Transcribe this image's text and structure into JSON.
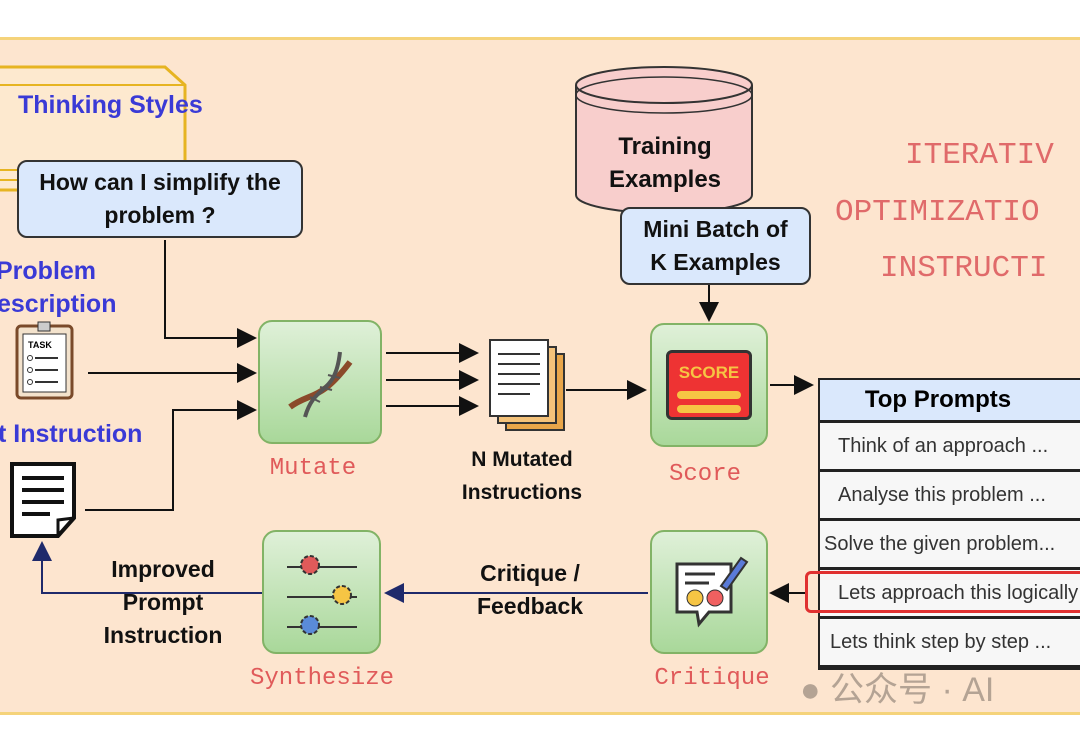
{
  "thinking_styles": {
    "title": "Thinking Styles",
    "example": "How can I simplify the problem ?"
  },
  "problem_description": {
    "line1": "Problem",
    "line2": "escription"
  },
  "instruction_label": "t Instruction",
  "mutate": {
    "label": "Mutate",
    "icon": "dna-icon"
  },
  "mutated": {
    "label_line1": "N Mutated",
    "label_line2": "Instructions"
  },
  "training": {
    "line1": "Training",
    "line2": "Examples"
  },
  "mini_batch": {
    "line1": "Mini Batch of",
    "line2": "K Examples"
  },
  "score": {
    "label": "Score",
    "icon_text": "SCORE"
  },
  "title": {
    "line1": "ITERATIV",
    "line2": "OPTIMIZATIO",
    "line3": "INSTRUCTI"
  },
  "top_prompts": {
    "header": "Top Prompts",
    "rows": [
      "Think of an approach ...",
      "Analyse this problem ...",
      "Solve the given problem...",
      "Lets approach this logically",
      "Lets think step by step ..."
    ],
    "highlighted_index": 3
  },
  "critique": {
    "label": "Critique",
    "feedback_line1": "Critique /",
    "feedback_line2": "Feedback"
  },
  "synthesize": {
    "label": "Synthesize",
    "improved_line1": "Improved",
    "improved_line2": "Prompt",
    "improved_line3": "Instruction"
  },
  "watermark": "公众号 · AI",
  "colors": {
    "background": "#fde5cf",
    "border": "#f5d37a",
    "accent_blue": "#3a3ad6",
    "label_red": "#e05a5a",
    "green_box": "#d5e8d4",
    "bubble_blue": "#dae8fc",
    "cylinder_pink": "#f8cecc",
    "feedback_arrow": "#1f2a6b"
  }
}
